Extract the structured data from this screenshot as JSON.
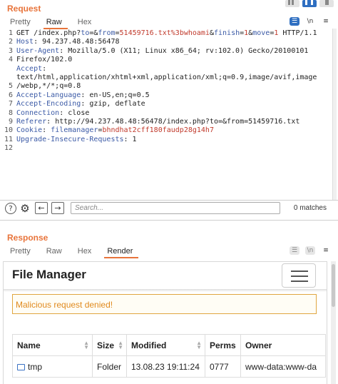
{
  "request": {
    "title": "Request",
    "tabs": [
      "Pretty",
      "Raw",
      "Hex"
    ],
    "active_tab": "Raw",
    "line_numbers": [
      "1",
      "2",
      "3",
      "4",
      "",
      "",
      "5",
      "6",
      "7",
      "8",
      "9",
      "10",
      "11",
      "12"
    ],
    "lines": [
      {
        "parts": [
          [
            "t",
            "GET /index.php?"
          ],
          [
            "k",
            "to"
          ],
          [
            "t",
            "=&"
          ],
          [
            "k",
            "from"
          ],
          [
            "t",
            "="
          ],
          [
            "r",
            "51459716.txt%3bwhoami"
          ],
          [
            "t",
            "&"
          ],
          [
            "k",
            "finish"
          ],
          [
            "t",
            "="
          ],
          [
            "r",
            "1"
          ],
          [
            "t",
            "&"
          ],
          [
            "k",
            "move"
          ],
          [
            "t",
            "="
          ],
          [
            "r",
            "1"
          ],
          [
            "t",
            " HTTP/1.1"
          ]
        ]
      },
      {
        "parts": [
          [
            "k",
            "Host"
          ],
          [
            "t",
            ": 94.237.48.48:56478"
          ]
        ]
      },
      {
        "parts": [
          [
            "k",
            "User-Agent"
          ],
          [
            "t",
            ": Mozilla/5.0 (X11; Linux x86_64; rv:102.0) Gecko/20100101"
          ]
        ]
      },
      {
        "parts": [
          [
            "t",
            "Firefox/102.0"
          ]
        ]
      },
      {
        "parts": [
          [
            "k",
            "Accept"
          ],
          [
            "t",
            ":"
          ]
        ]
      },
      {
        "parts": [
          [
            "t",
            "text/html,application/xhtml+xml,application/xml;q=0.9,image/avif,image"
          ]
        ]
      },
      {
        "parts": [
          [
            "t",
            "/webp,*/*;q=0.8"
          ]
        ]
      },
      {
        "parts": [
          [
            "k",
            "Accept-Language"
          ],
          [
            "t",
            ": en-US,en;q=0.5"
          ]
        ]
      },
      {
        "parts": [
          [
            "k",
            "Accept-Encoding"
          ],
          [
            "t",
            ": gzip, deflate"
          ]
        ]
      },
      {
        "parts": [
          [
            "k",
            "Connection"
          ],
          [
            "t",
            ": close"
          ]
        ]
      },
      {
        "parts": [
          [
            "k",
            "Referer"
          ],
          [
            "t",
            ": http://94.237.48.48:56478/index.php?to=&from=51459716.txt"
          ]
        ]
      },
      {
        "parts": [
          [
            "k",
            "Cookie"
          ],
          [
            "t",
            ": "
          ],
          [
            "k",
            "filemanager"
          ],
          [
            "t",
            "="
          ],
          [
            "r",
            "bhndhat2cff180faudp28g14h7"
          ]
        ]
      },
      {
        "parts": [
          [
            "k",
            "Upgrade-Insecure-Requests"
          ],
          [
            "t",
            ": 1"
          ]
        ]
      },
      {
        "parts": [
          [
            "t",
            ""
          ]
        ]
      },
      {
        "parts": [
          [
            "t",
            ""
          ]
        ]
      }
    ],
    "search": {
      "placeholder": "Search...",
      "matches": "0 matches"
    }
  },
  "response": {
    "title": "Response",
    "tabs": [
      "Pretty",
      "Raw",
      "Hex",
      "Render"
    ],
    "active_tab": "Render",
    "render": {
      "app_title": "File Manager",
      "alert": "Malicious request denied!",
      "columns": [
        "Name",
        "Size",
        "Modified",
        "Perms",
        "Owner"
      ],
      "rows": [
        {
          "name": "tmp",
          "size": "Folder",
          "modified": "13.08.23 19:11:24",
          "perms": "0777",
          "owner": "www-data:www-da"
        }
      ]
    }
  },
  "icons": {
    "help": "help-icon",
    "settings": "gear-icon",
    "back": "arrow-left-icon",
    "forward": "arrow-right-icon",
    "menu": "hamburger-icon",
    "folder": "folder-icon"
  },
  "colors": {
    "accent": "#e8743b",
    "key": "#3b5aa6",
    "value": "#c0392b",
    "alert": "#e08a1e",
    "active_blue": "#2f6fc1"
  }
}
